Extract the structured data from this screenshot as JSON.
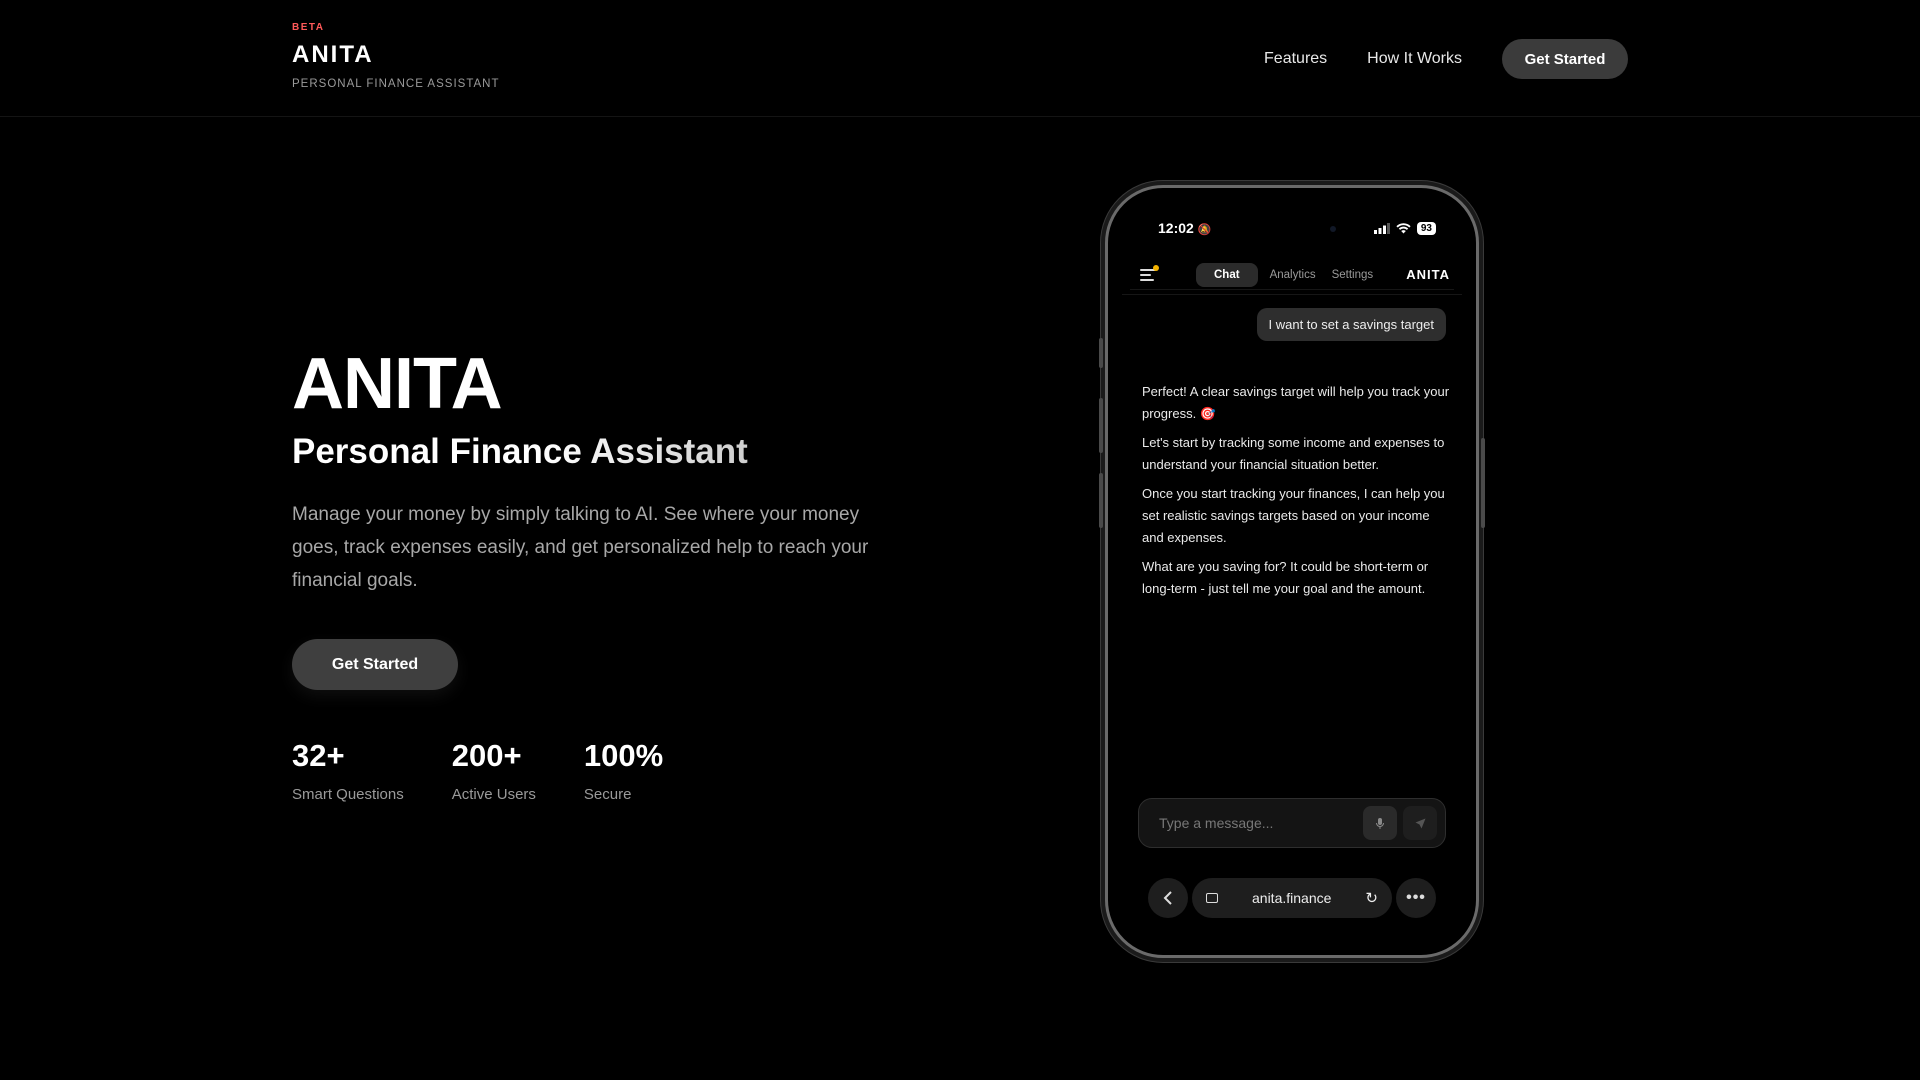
{
  "header": {
    "beta": "BETA",
    "brand": "ANITA",
    "tagline": "PERSONAL FINANCE ASSISTANT",
    "nav": [
      "Features",
      "How It Works"
    ],
    "cta": "Get Started"
  },
  "hero": {
    "title": "ANITA",
    "subtitle": "Personal Finance Assistant",
    "description": "Manage your money by simply talking to AI. See where your money goes, track expenses easily, and get personalized help to reach your financial goals.",
    "cta": "Get Started",
    "stats": [
      {
        "value": "32+",
        "label": "Smart Questions"
      },
      {
        "value": "200+",
        "label": "Active Users"
      },
      {
        "value": "100%",
        "label": "Secure"
      }
    ]
  },
  "phone": {
    "time": "12:02",
    "battery": "93",
    "tabs": [
      "Chat",
      "Analytics",
      "Settings"
    ],
    "app_brand": "ANITA",
    "user_message": "I want to set a savings target",
    "bot_messages": [
      "Perfect! A clear savings target will help you track your progress. 🎯",
      "Let's start by tracking some income and expenses to understand your financial situation better.",
      "Once you start tracking your finances, I can help you set realistic savings targets based on your income and expenses.",
      "What are you saving for? It could be short-term or long-term - just tell me your goal and the amount."
    ],
    "input_placeholder": "Type a message...",
    "url": "anita.finance"
  },
  "colors": {
    "background": "#000000",
    "beta": "#ff5a5a",
    "button": "#3b3b3b",
    "notification_dot": "#f5b400"
  }
}
